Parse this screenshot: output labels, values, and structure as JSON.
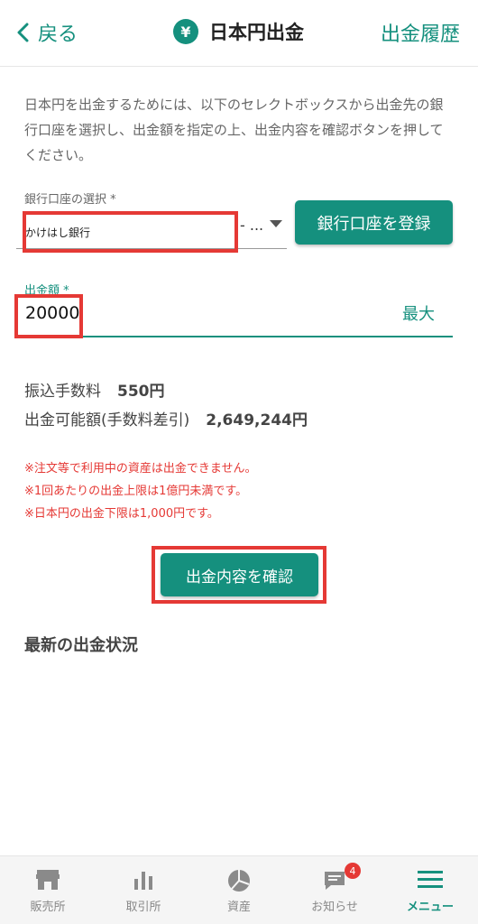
{
  "header": {
    "back_label": "戻る",
    "title": "日本円出金",
    "yen_symbol": "¥",
    "history_label": "出金履歴"
  },
  "intro": {
    "text": "日本円を出金するためには、以下のセレクトボックスから出金先の銀行口座を選択し、出金額を指定の上、出金内容を確認ボタンを押してください。"
  },
  "bank": {
    "label": "銀行口座の選択 *",
    "selected_value": "かけはし銀行",
    "extra": "- ...",
    "register_label": "銀行口座を登録"
  },
  "amount": {
    "label": "出金額 *",
    "value": "20000",
    "max_label": "最大"
  },
  "fees": {
    "transfer_fee_label": "振込手数料",
    "transfer_fee_value": "550円",
    "available_label": "出金可能額(手数料差引)",
    "available_value": "2,649,244円"
  },
  "notes": [
    "※注文等で利用中の資産は出金できません。",
    "※1回あたりの出金上限は1億円未満です。",
    "※日本円の出金下限は1,000円です。"
  ],
  "confirm_label": "出金内容を確認",
  "recent_title": "最新の出金状況",
  "bottom_nav": {
    "items": [
      {
        "label": "販売所",
        "icon": "store-icon"
      },
      {
        "label": "取引所",
        "icon": "bar-chart-icon"
      },
      {
        "label": "資産",
        "icon": "pie-chart-icon"
      },
      {
        "label": "お知らせ",
        "icon": "message-icon",
        "badge": "4"
      },
      {
        "label": "メニュー",
        "icon": "menu-icon",
        "active": true
      }
    ]
  },
  "colors": {
    "accent": "#15907e",
    "highlight": "#e53935"
  }
}
